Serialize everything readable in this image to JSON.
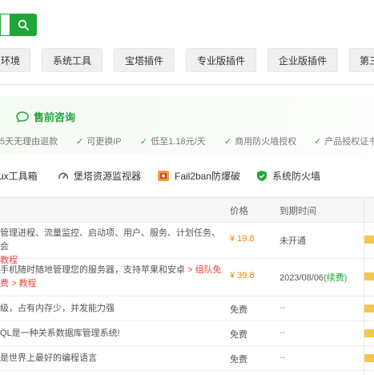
{
  "tabs": [
    "环境",
    "系统工具",
    "宝塔插件",
    "专业版插件",
    "企业版插件",
    "第三"
  ],
  "promo": {
    "presale": "售前咨询",
    "features": [
      "5天无理由退款",
      "可更换IP",
      "低至1.18元/天",
      "商用防火墙授权",
      "产品授权证书"
    ]
  },
  "plugin_links": [
    "ux工具箱",
    "堡塔资源监视器",
    "Fail2ban防爆破",
    "系统防火墙"
  ],
  "table": {
    "headers": {
      "price": "价格",
      "expire": "到期时间"
    },
    "rows": [
      {
        "desc1": "管理进程、流量监控、启动项、用户、服务、计划任务、会",
        "desc2": "教程",
        "price": "¥ 19.8",
        "expire": "未开通"
      },
      {
        "desc1": "手机随时随地管理您的服务器，支持苹果和安卓",
        "desc1_link": "> 组队免",
        "desc2a": "费",
        "desc2": "> 教程",
        "price": "¥ 39.8",
        "expire": "2023/08/06",
        "renew": "(续费)"
      },
      {
        "desc1": "级，占有内存少，并发能力强",
        "price": "免费",
        "expire": "--"
      },
      {
        "desc1": "QL是一种关系数据库管理系统!",
        "price": "免费",
        "expire": "--"
      },
      {
        "desc1": "是世界上最好的编程语言",
        "price": "免费",
        "expire": "--"
      }
    ]
  },
  "colors": {
    "accent": "#20a53a",
    "price": "#ff7f00",
    "link": "#f0443c"
  }
}
